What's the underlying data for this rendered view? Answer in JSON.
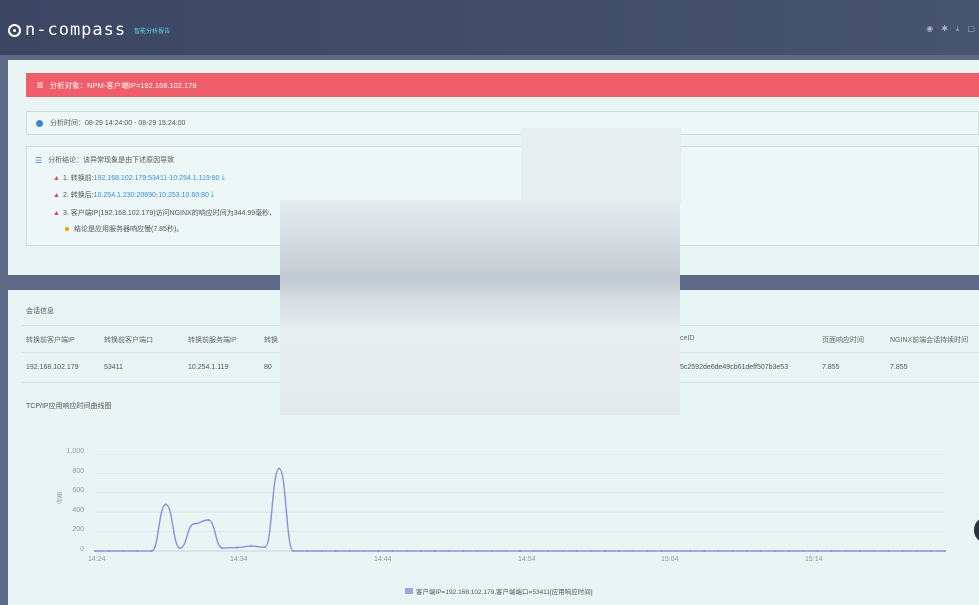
{
  "header": {
    "logo_text": "n-compass",
    "subtitle": "智能分析报告",
    "icons": [
      "eye-icon",
      "settings-icon",
      "download-icon",
      "more-icon"
    ]
  },
  "banner": {
    "text": "分析对象：NPM-客户端IP=192.168.102.179",
    "color": "#ef5e6a"
  },
  "analysis_time": {
    "text": "分析时间：08-29 14:24:00 - 08-29 15:24:00"
  },
  "conclusion": {
    "title": "分析结论：该异常现象是由下述原因导致",
    "items": [
      {
        "prefix": "1. 转换前:",
        "link": "192.168.102.179:53411-10.254.1.119:80"
      },
      {
        "prefix": "2. 转换后:",
        "link": "10.254.1.230:20690-10.253.10.60:80"
      },
      {
        "prefix": "3. 客户端IP(192.168.102.179)访问NGINX的响应时间为344.99毫秒、",
        "link": ""
      }
    ],
    "note": "结论是应用服务器响应慢(7.85秒)。"
  },
  "session": {
    "title": "会话信息",
    "columns": [
      "转换前客户端IP",
      "转换前客户端口",
      "转换前服务端IP",
      "转换",
      "ceID",
      "页面响应时间",
      "NGINX前端会话持续时间"
    ],
    "row": [
      "192.168.102.179",
      "53411",
      "10.254.1.119",
      "80",
      "5c2592de6de49cb61deff507b3e53",
      "7.855",
      "7.855"
    ]
  },
  "chart_title": "TCP/IP应用响应时间曲线图",
  "chart_data": {
    "type": "line",
    "title": "TCP/IP应用响应时间曲线图",
    "ylabel": "毫秒",
    "ylim": [
      0,
      1000
    ],
    "y_ticks": [
      "0",
      "200",
      "400",
      "600",
      "800",
      "1,000"
    ],
    "x_ticks": [
      "14:24",
      "14:34",
      "14:44",
      "14:54",
      "15:04",
      "15:14"
    ],
    "x": [
      "14:24",
      "14:25",
      "14:26",
      "14:27",
      "14:28",
      "14:29",
      "14:30",
      "14:31",
      "14:32",
      "14:33",
      "14:34",
      "14:35",
      "14:36",
      "14:37",
      "14:38",
      "14:39",
      "14:40",
      "14:41",
      "14:42",
      "14:43",
      "14:44",
      "14:45",
      "14:46",
      "14:47",
      "14:48",
      "14:49",
      "14:50",
      "14:51",
      "14:52",
      "14:53",
      "14:54",
      "14:55",
      "14:56",
      "14:57",
      "14:58",
      "14:59",
      "15:00",
      "15:01",
      "15:02",
      "15:03",
      "15:04",
      "15:05",
      "15:06",
      "15:07",
      "15:08",
      "15:09",
      "15:10",
      "15:11",
      "15:12",
      "15:13",
      "15:14",
      "15:15",
      "15:16",
      "15:17",
      "15:18",
      "15:19",
      "15:20",
      "15:21",
      "15:22",
      "15:23",
      "15:24"
    ],
    "series": [
      {
        "name": "客户端IP=192.168.102.179,客户端端口=53411[应用响应时间]",
        "values": [
          0,
          0,
          0,
          0,
          0,
          480,
          30,
          280,
          320,
          30,
          35,
          50,
          40,
          850,
          0,
          0,
          0,
          0,
          0,
          0,
          0,
          0,
          0,
          0,
          0,
          0,
          0,
          0,
          0,
          0,
          0,
          0,
          0,
          0,
          0,
          0,
          0,
          0,
          0,
          0,
          0,
          0,
          0,
          0,
          0,
          0,
          0,
          0,
          0,
          0,
          0,
          0,
          0,
          0,
          0,
          0,
          0,
          0,
          0,
          0,
          0
        ]
      }
    ],
    "color": "#8f8ce0"
  }
}
